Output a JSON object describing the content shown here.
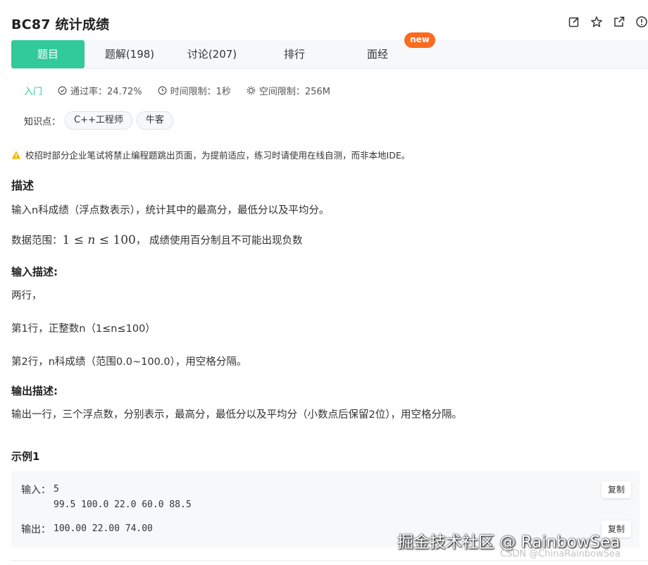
{
  "problem": {
    "title": "BC87  统计成绩"
  },
  "tabs": [
    {
      "label": "题目"
    },
    {
      "label": "题解(198)"
    },
    {
      "label": "讨论(207)"
    },
    {
      "label": "排行"
    },
    {
      "label": "面经"
    }
  ],
  "new_badge": "new",
  "meta": {
    "level": "入门",
    "pass_rate": "通过率：24.72%",
    "time_limit": "时间限制：1秒",
    "space_limit": "空间限制：256M"
  },
  "knowledge": {
    "label": "知识点：",
    "chips": [
      "C++工程师",
      "牛客"
    ]
  },
  "notice": "校招时部分企业笔试将禁止编程题跳出页面，为提前适应，练习时请使用在线自测，而非本地IDE。",
  "description": {
    "heading": "描述",
    "line1": "输入n科成绩（浮点数表示），统计其中的最高分，最低分以及平均分。",
    "range_prefix": "数据范围：",
    "range_math_low": "1",
    "range_math_le1": "≤",
    "range_math_var": "n",
    "range_math_le2": "≤",
    "range_math_high": "100",
    "range_suffix": "，  成绩使用百分制且不可能出现负数"
  },
  "input_desc": {
    "heading": "输入描述:",
    "lines": [
      "两行，",
      "第1行，正整数n（1≤n≤100）",
      "第2行，n科成绩（范围0.0~100.0），用空格分隔。"
    ]
  },
  "output_desc": {
    "heading": "输出描述:",
    "line": "输出一行，三个浮点数，分别表示，最高分，最低分以及平均分（小数点后保留2位），用空格分隔。"
  },
  "example": {
    "heading": "示例1",
    "input_label": "输入：",
    "input_line1": "5",
    "input_line2": "99.5 100.0 22.0 60.0 88.5",
    "output_label": "输出：",
    "output_line": "100.00 22.00 74.00",
    "copy_label": "复制"
  },
  "watermark": {
    "main": "掘金技术社区 @ RainbowSea",
    "sub": "CSDN @ChinaRainbowSea"
  },
  "colors": {
    "accent": "#32ca99",
    "badge": "#fa6a1f",
    "warning": "#f5b800"
  }
}
